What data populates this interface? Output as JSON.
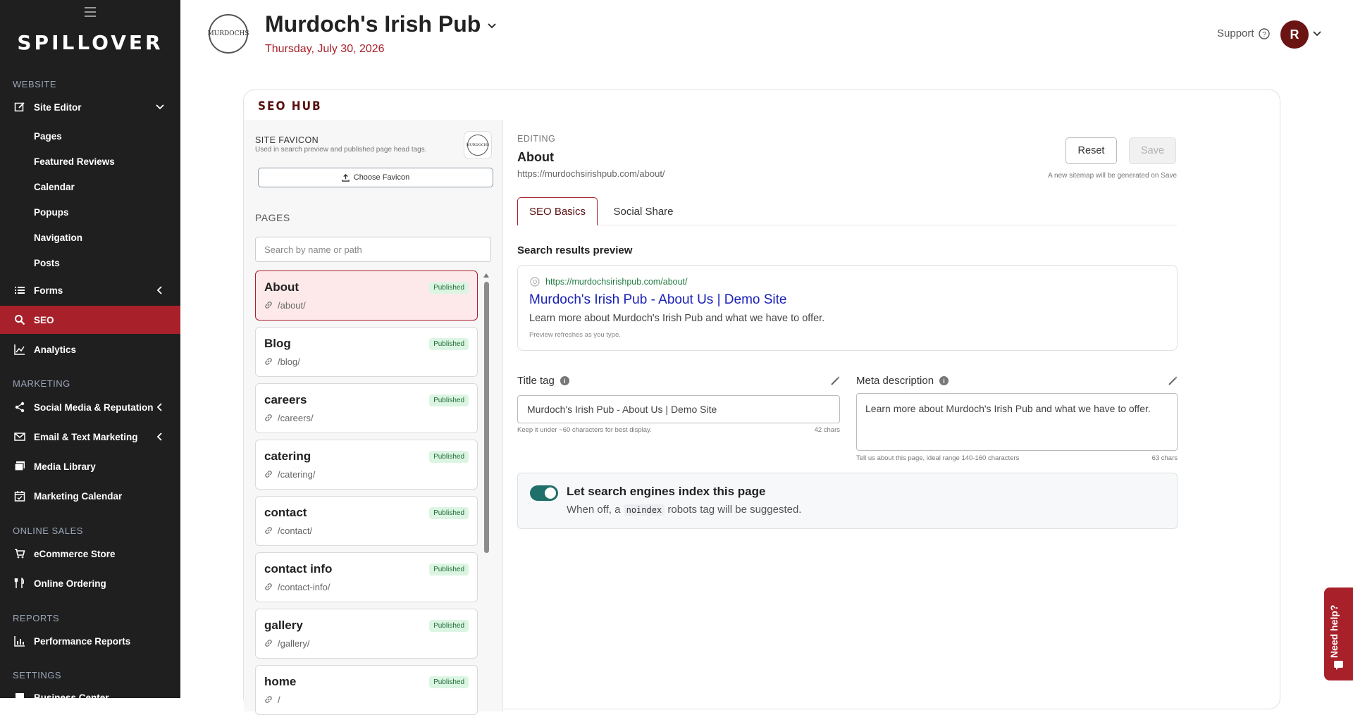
{
  "sidebar": {
    "logo": "SPILLOVER",
    "sections": {
      "website": "WEBSITE",
      "marketing": "MARKETING",
      "online_sales": "ONLINE SALES",
      "reports": "REPORTS",
      "settings": "SETTINGS"
    },
    "site_editor": "Site Editor",
    "site_editor_sub": [
      "Pages",
      "Featured Reviews",
      "Calendar",
      "Popups",
      "Navigation",
      "Posts"
    ],
    "forms": "Forms",
    "seo": "SEO",
    "analytics": "Analytics",
    "social": "Social Media & Reputation",
    "email": "Email & Text Marketing",
    "media": "Media Library",
    "marketing_calendar": "Marketing Calendar",
    "ecommerce": "eCommerce Store",
    "online_ordering": "Online Ordering",
    "performance": "Performance Reports",
    "business_center": "Business Center"
  },
  "header": {
    "business_name": "Murdoch's Irish Pub",
    "date": "Thursday, July 30, 2026",
    "support": "Support",
    "avatar_initial": "R",
    "logo_text": "MURDOCHS"
  },
  "seo_hub": {
    "title": "SEO HUB",
    "favicon": {
      "title": "SITE FAVICON",
      "subtitle": "Used in search preview and published page head tags.",
      "choose_label": "Choose Favicon"
    },
    "pages_title": "PAGES",
    "search_placeholder": "Search by name or path",
    "pages": [
      {
        "name": "About",
        "path": "/about/",
        "status": "Published"
      },
      {
        "name": "Blog",
        "path": "/blog/",
        "status": "Published"
      },
      {
        "name": "careers",
        "path": "/careers/",
        "status": "Published"
      },
      {
        "name": "catering",
        "path": "/catering/",
        "status": "Published"
      },
      {
        "name": "contact",
        "path": "/contact/",
        "status": "Published"
      },
      {
        "name": "contact info",
        "path": "/contact-info/",
        "status": "Published"
      },
      {
        "name": "gallery",
        "path": "/gallery/",
        "status": "Published"
      },
      {
        "name": "home",
        "path": "/",
        "status": "Published"
      }
    ]
  },
  "editor": {
    "editing_label": "EDITING",
    "page_name": "About",
    "page_url": "https://murdochsirishpub.com/about/",
    "reset_label": "Reset",
    "save_label": "Save",
    "sitemap_note": "A new sitemap will be generated on Save",
    "tabs": [
      "SEO Basics",
      "Social Share"
    ],
    "preview": {
      "title": "Search results preview",
      "url": "https://murdochsirishpub.com/about/",
      "headline": "Murdoch's Irish Pub - About Us | Demo Site",
      "description": "Learn more about Murdoch's Irish Pub and what we have to offer.",
      "note": "Preview refreshes as you type."
    },
    "title_tag": {
      "label": "Title tag",
      "value": "Murdoch's Irish Pub - About Us | Demo Site",
      "help": "Keep it under ~60 characters for best display.",
      "count": "42 chars"
    },
    "meta_description": {
      "label": "Meta description",
      "value": "Learn more about Murdoch's Irish Pub and what we have to offer.",
      "help": "Tell us about this page, ideal range 140-160 characters",
      "count": "63 chars"
    },
    "indexing": {
      "title": "Let search engines index this page",
      "sub_before": "When off, a",
      "code": "noindex",
      "sub_after": "robots tag will be suggested.",
      "enabled": true
    }
  },
  "need_help": "Need help?",
  "colors": {
    "accent": "#a8202a",
    "sidebar_bg": "#1f1f1f",
    "brand_dark": "#5a1010"
  }
}
